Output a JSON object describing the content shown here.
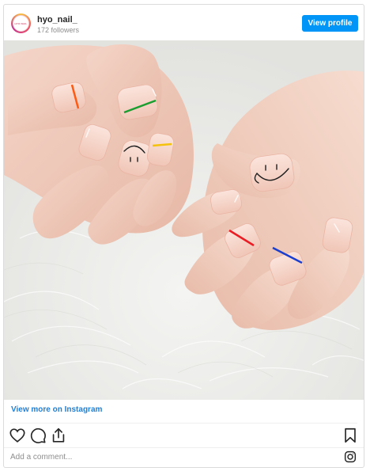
{
  "post": {
    "username": "hyo_nail_",
    "followers": "172 followers",
    "avatar_text": "HYO NAIL",
    "view_profile_label": "View profile",
    "view_more_label": "View more on Instagram",
    "comment_placeholder": "Add a comment...",
    "accent_color": "#0095f6",
    "link_color": "#1e80d8"
  },
  "icons": {
    "like": "heart-icon",
    "comment": "comment-icon",
    "share": "share-icon",
    "save": "bookmark-icon",
    "instagram": "instagram-icon"
  }
}
